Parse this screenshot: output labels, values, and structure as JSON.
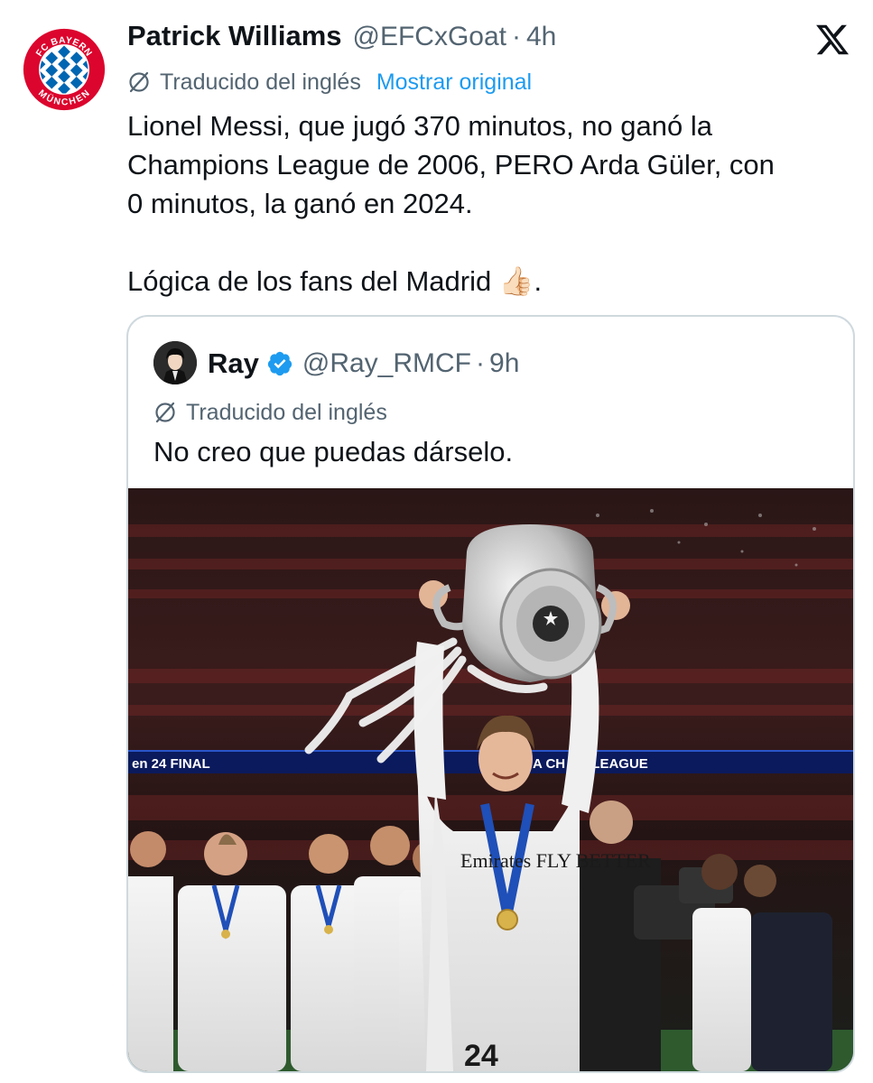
{
  "tweet": {
    "author_name": "Patrick Williams",
    "handle": "@EFCxGoat",
    "separator": "·",
    "time": "4h",
    "avatar_icon": "fc-bayern-munchen-crest-icon",
    "avatar_text_top": "FC BAYERN",
    "avatar_text_bottom": "MÜNCHEN",
    "translated_label": "Traducido del inglés",
    "show_original_label": "Mostrar original",
    "text_lines": [
      "Lionel Messi, que jugó 370 minutos, no ganó la",
      "Champions League de 2006, PERO Arda Güler, con",
      "0 minutos, la ganó en 2024."
    ],
    "text_line_2": "Lógica de los fans del Madrid",
    "emoji": "👍🏻",
    "text_line_2_end": "."
  },
  "quote": {
    "author_name": "Ray",
    "verified_icon": "verified-badge-icon",
    "handle": "@Ray_RMCF",
    "separator": "·",
    "time": "9h",
    "translated_label": "Traducido del inglés",
    "text": "No creo que puedas dárselo.",
    "photo": {
      "description_icon": "trophy-celebration-photo",
      "banner_left": "en 24 FINAL",
      "banner_right": "A CH    NS LEAGUE",
      "shirt_sponsor": "Emirates FLY BETTER",
      "shirt_number": "24"
    }
  },
  "colors": {
    "text_primary": "#0f1419",
    "text_secondary": "#536471",
    "link_blue": "#1d9bf0",
    "border": "#cfd9de",
    "bayern_red": "#dc052d",
    "bayern_blue": "#0066b2"
  },
  "icons": {
    "x_logo": "x-logo-icon",
    "translate": "translate-globe-icon"
  }
}
